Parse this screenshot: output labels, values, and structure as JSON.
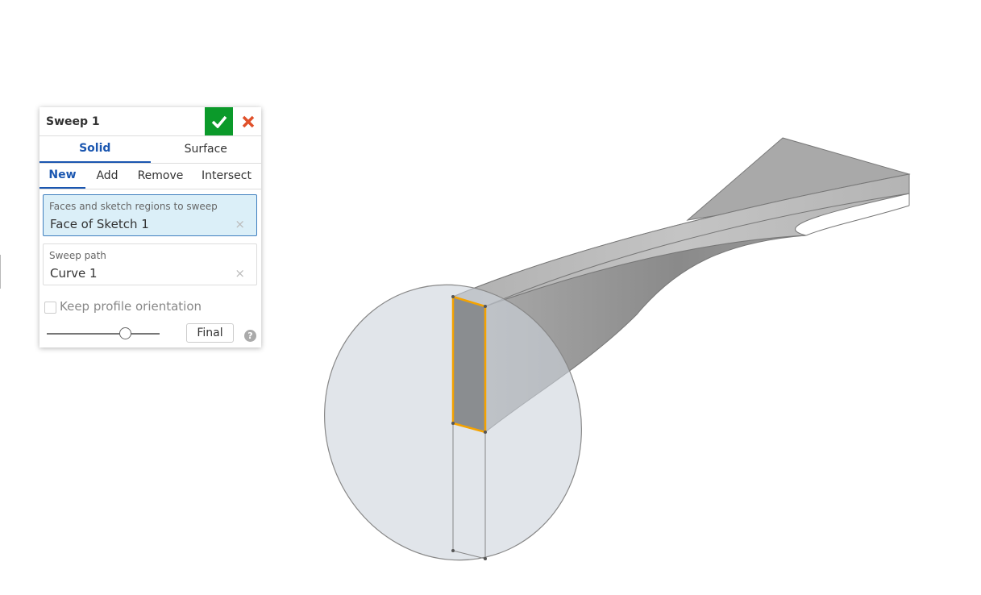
{
  "dialog": {
    "title": "Sweep 1",
    "accept_icon": "checkmark-icon",
    "cancel_icon": "close-icon",
    "body_tabs": [
      {
        "label": "Solid",
        "active": true
      },
      {
        "label": "Surface",
        "active": false
      }
    ],
    "operation_tabs": [
      {
        "label": "New",
        "active": true
      },
      {
        "label": "Add",
        "active": false
      },
      {
        "label": "Remove",
        "active": false
      },
      {
        "label": "Intersect",
        "active": false
      }
    ],
    "faces_field": {
      "label": "Faces and sketch regions to sweep",
      "value": "Face of Sketch 1",
      "clear": "×"
    },
    "path_field": {
      "label": "Sweep path",
      "value": "Curve 1",
      "clear": "×"
    },
    "keep_orientation": {
      "label": "Keep profile orientation",
      "checked": false
    },
    "preview_slider_value": 0.7,
    "final_label": "Final",
    "help_label": "?"
  },
  "colors": {
    "accept": "#0b9a2a",
    "cancel": "#e0502a",
    "accent": "#1a56b0",
    "highlight": "#f5a300"
  }
}
